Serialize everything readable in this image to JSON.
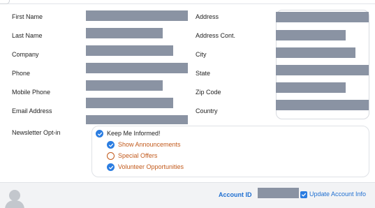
{
  "contact": {
    "first_name": "First Name",
    "last_name": "Last Name",
    "company": "Company",
    "phone": "Phone",
    "mobile_phone": "Mobile Phone",
    "email": "Email Address"
  },
  "address": {
    "address": "Address",
    "address_cont": "Address Cont.",
    "city": "City",
    "state": "State",
    "zip": "Zip Code",
    "country": "Country"
  },
  "newsletter": {
    "label": "Newsletter Opt-in",
    "main_option": "Keep Me Informed!",
    "options": [
      {
        "label": "Show Announcements",
        "checked": true
      },
      {
        "label": "Special Offers",
        "checked": false
      },
      {
        "label": "Volunteer Opportunities",
        "checked": true
      }
    ]
  },
  "footer": {
    "account_id_label": "Account ID",
    "update_label": "Update Account Info"
  },
  "colors": {
    "accent_blue": "#2b7de1",
    "link_blue": "#1f6fd1",
    "option_orange": "#c25a1c",
    "redaction_gray": "#8a93a3"
  }
}
